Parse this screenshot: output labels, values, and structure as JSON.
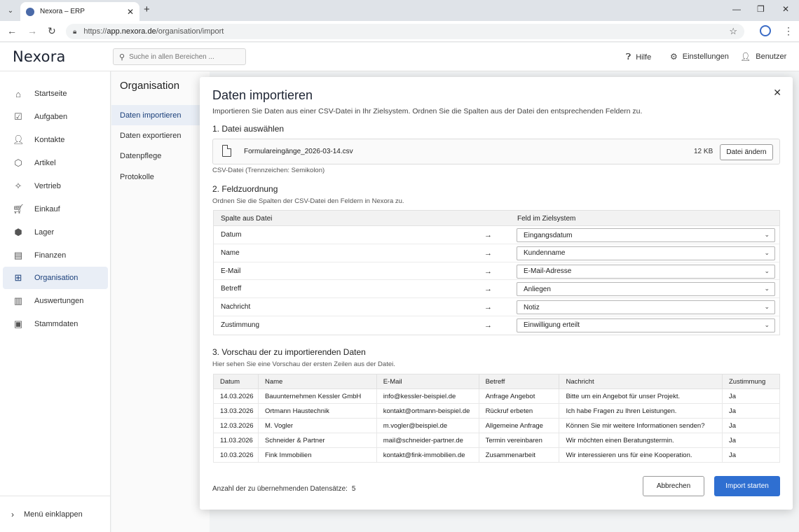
{
  "browser": {
    "tab_title": "Nexora – ERP",
    "url_prefix": "https://",
    "url_domain": "app.nexora.de",
    "url_path": "/organisation/import"
  },
  "header": {
    "logo": "Nexora",
    "search_placeholder": "Suche in allen Bereichen ...",
    "help": "Hilfe",
    "settings": "Einstellungen",
    "user": "Benutzer"
  },
  "sidebar": {
    "items": [
      {
        "label": "Startseite",
        "icon": "home-icon"
      },
      {
        "label": "Aufgaben",
        "icon": "tasks-icon"
      },
      {
        "label": "Kontakte",
        "icon": "contacts-icon"
      },
      {
        "label": "Artikel",
        "icon": "box-icon"
      },
      {
        "label": "Vertrieb",
        "icon": "sales-icon"
      },
      {
        "label": "Einkauf",
        "icon": "cart-icon"
      },
      {
        "label": "Lager",
        "icon": "warehouse-icon"
      },
      {
        "label": "Finanzen",
        "icon": "finance-icon"
      },
      {
        "label": "Organisation",
        "icon": "org-icon"
      },
      {
        "label": "Auswertungen",
        "icon": "chart-icon"
      },
      {
        "label": "Stammdaten",
        "icon": "master-data-icon"
      }
    ],
    "collapse_label": "Menü einklappen"
  },
  "subnav": {
    "title": "Organisation",
    "items": [
      "Daten importieren",
      "Daten exportieren",
      "Datenpflege",
      "Protokolle"
    ]
  },
  "modal": {
    "title": "Daten importieren",
    "subtitle": "Importieren Sie Daten aus einer CSV-Datei in Ihr Zielsystem. Ordnen Sie die Spalten aus der Datei den entsprechenden Feldern zu.",
    "section1": {
      "title": "1. Datei auswählen",
      "file_name": "Formulareingänge_2026-03-14.csv",
      "file_size": "12 KB",
      "change_button": "Datei ändern",
      "file_info": "CSV-Datei (Trennzeichen: Semikolon)"
    },
    "section2": {
      "title": "2. Feldzuordnung",
      "desc": "Ordnen Sie die Spalten der CSV-Datei den Feldern in Nexora zu.",
      "col_source": "Spalte aus Datei",
      "col_target": "Feld im Zielsystem",
      "arrow": "→",
      "rows": [
        {
          "source": "Datum",
          "target": "Eingangsdatum"
        },
        {
          "source": "Name",
          "target": "Kundenname"
        },
        {
          "source": "E-Mail",
          "target": "E-Mail-Adresse"
        },
        {
          "source": "Betreff",
          "target": "Anliegen"
        },
        {
          "source": "Nachricht",
          "target": "Notiz"
        },
        {
          "source": "Zustimmung",
          "target": "Einwilligung erteilt"
        }
      ]
    },
    "section3": {
      "title": "3. Vorschau der zu importierenden Daten",
      "desc": "Hier sehen Sie eine Vorschau der ersten Zeilen aus der Datei.",
      "headers": [
        "Datum",
        "Name",
        "E-Mail",
        "Betreff",
        "Nachricht",
        "Zustimmung"
      ],
      "rows": [
        [
          "14.03.2026",
          "Bauunternehmen Kessler GmbH",
          "info@kessler-beispiel.de",
          "Anfrage Angebot",
          "Bitte um ein Angebot für unser Projekt.",
          "Ja"
        ],
        [
          "13.03.2026",
          "Ortmann Haustechnik",
          "kontakt@ortmann-beispiel.de",
          "Rückruf erbeten",
          "Ich habe Fragen zu Ihren Leistungen.",
          "Ja"
        ],
        [
          "12.03.2026",
          "M. Vogler",
          "m.vogler@beispiel.de",
          "Allgemeine Anfrage",
          "Können Sie mir weitere Informationen senden?",
          "Ja"
        ],
        [
          "11.03.2026",
          "Schneider & Partner",
          "mail@schneider-partner.de",
          "Termin vereinbaren",
          "Wir möchten einen Beratungstermin.",
          "Ja"
        ],
        [
          "10.03.2026",
          "Fink Immobilien",
          "kontakt@fink-immobilien.de",
          "Zusammenarbeit",
          "Wir interessieren uns für eine Kooperation.",
          "Ja"
        ]
      ]
    },
    "footer": {
      "count_label": "Anzahl der zu übernehmenden Datensätze:",
      "count_value": "5",
      "cancel": "Abbrechen",
      "import": "Import starten"
    }
  }
}
